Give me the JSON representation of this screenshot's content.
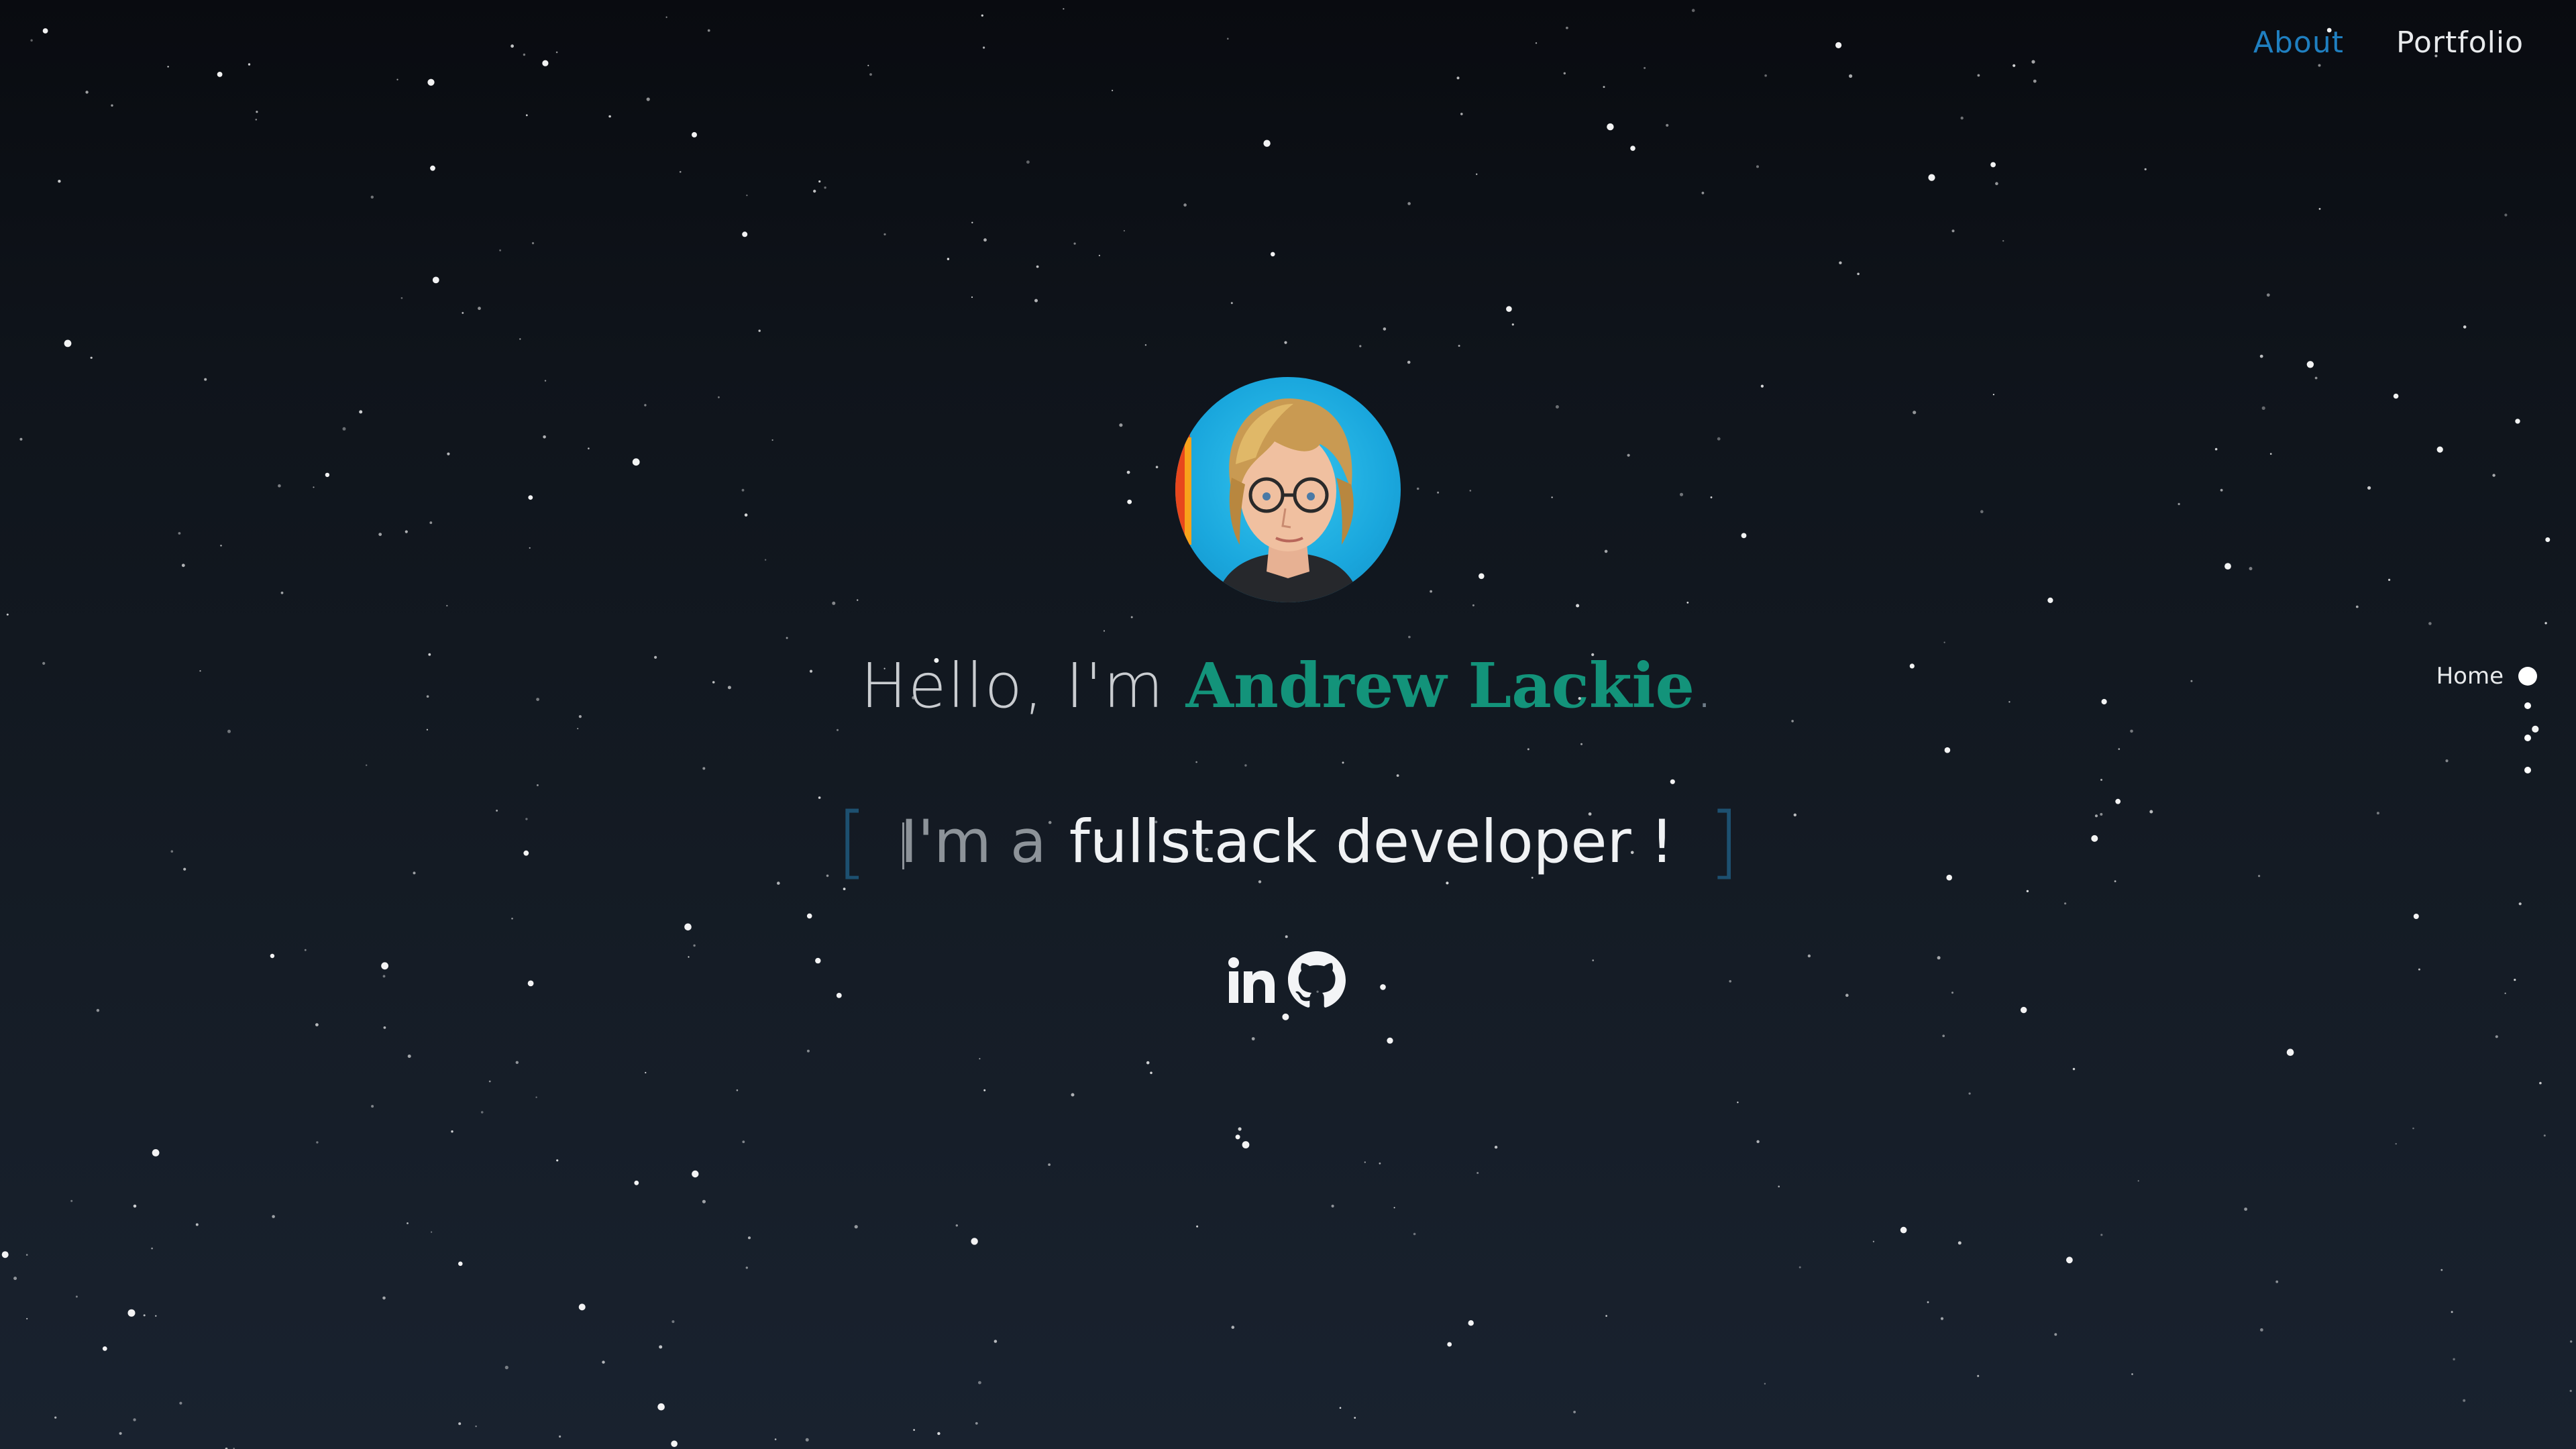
{
  "nav": {
    "about_label": "About",
    "portfolio_label": "Portfolio"
  },
  "hero": {
    "greeting": "Hello, I'm ",
    "name": "Andrew Lackie",
    "name_suffix": ".",
    "role_prefix": "I'm a",
    "role_word": "fullstack developer !",
    "bracket_left": "[",
    "bracket_right": "]"
  },
  "social": {
    "linkedin_icon": "linkedin-icon",
    "github_icon": "github-icon"
  },
  "sidenav": {
    "active_label": "Home"
  },
  "colors": {
    "accent_blue": "#1f7fc0",
    "name_green": "#13937a",
    "bracket": "#1d5070"
  }
}
